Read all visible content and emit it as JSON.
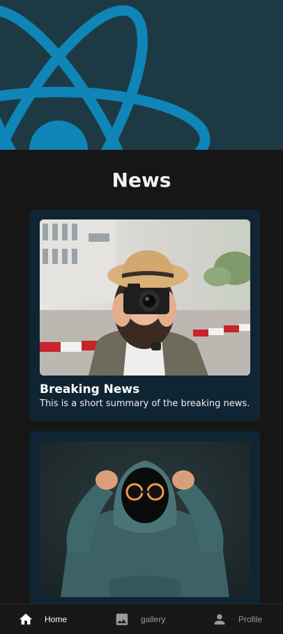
{
  "colors": {
    "hero_bg": "#1d3a44",
    "logo": "#0f85b8",
    "page_bg": "#161617",
    "card_bg": "#0f2533",
    "nav_active": "#ffffff",
    "nav_inactive": "#9a9a9a"
  },
  "hero": {
    "logo_icon": "react-atom-icon"
  },
  "page": {
    "title": "News"
  },
  "cards": [
    {
      "title": "Breaking News",
      "summary": "This is a short summary of the breaking news.",
      "image": "woman-photographing-with-camera"
    },
    {
      "title": "",
      "summary": "",
      "image": "hooded-figure-glowing-goggles"
    }
  ],
  "nav": {
    "items": [
      {
        "label": "Home",
        "icon": "home-icon",
        "active": true
      },
      {
        "label": "gallery",
        "icon": "image-icon",
        "active": false
      },
      {
        "label": "Profile",
        "icon": "person-icon",
        "active": false
      }
    ]
  }
}
